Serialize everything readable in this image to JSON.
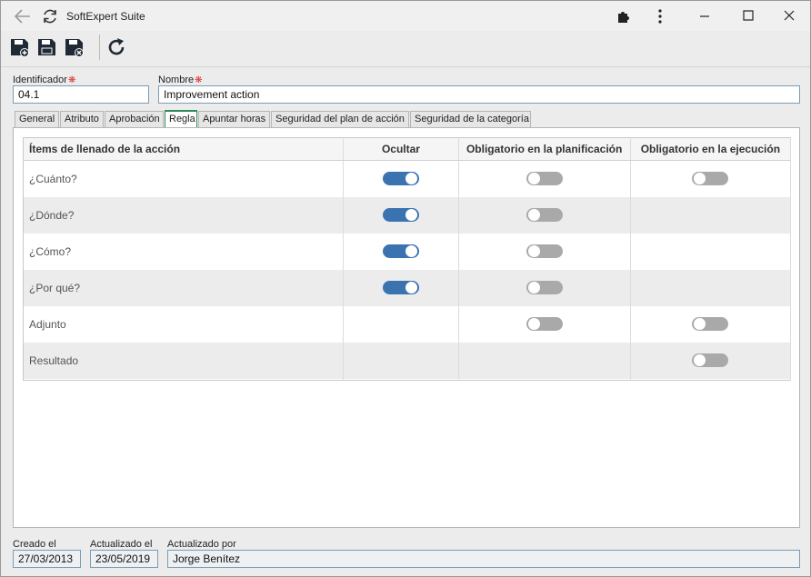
{
  "window": {
    "title": "SoftExpert Suite"
  },
  "form": {
    "id_label": "Identificador",
    "id_value": "04.1",
    "name_label": "Nombre",
    "name_value": "Improvement action",
    "required_marker": "❋"
  },
  "tabs": [
    {
      "label": "General",
      "active": false
    },
    {
      "label": "Atributo",
      "active": false
    },
    {
      "label": "Aprobación",
      "active": false
    },
    {
      "label": "Regla",
      "active": true
    },
    {
      "label": "Apuntar horas",
      "active": false
    },
    {
      "label": "Seguridad del plan de acción",
      "active": false
    },
    {
      "label": "Seguridad de la categoría",
      "active": false
    }
  ],
  "grid": {
    "headers": [
      "Ítems de llenado de la acción",
      "Ocultar",
      "Obligatorio en la planificación",
      "Obligatorio en la ejecución"
    ],
    "rows": [
      {
        "label": "¿Cuánto?",
        "hide": "on",
        "plan": "off",
        "exec": "off"
      },
      {
        "label": "¿Dónde?",
        "hide": "on",
        "plan": "off",
        "exec": null
      },
      {
        "label": "¿Cómo?",
        "hide": "on",
        "plan": "off",
        "exec": null
      },
      {
        "label": "¿Por qué?",
        "hide": "on",
        "plan": "off",
        "exec": null
      },
      {
        "label": "Adjunto",
        "hide": null,
        "plan": "off",
        "exec": "off"
      },
      {
        "label": "Resultado",
        "hide": null,
        "plan": null,
        "exec": "off"
      }
    ]
  },
  "footer": {
    "created_label": "Creado el",
    "created_value": "27/03/2013",
    "updated_label": "Actualizado el",
    "updated_value": "23/05/2019",
    "updated_by_label": "Actualizado por",
    "updated_by_value": "Jorge Benítez"
  },
  "colors": {
    "toggle_on": "#3b73b0",
    "toggle_off": "#a9a9a9",
    "active_tab_accent": "#2e8b57",
    "required": "#e03030"
  }
}
